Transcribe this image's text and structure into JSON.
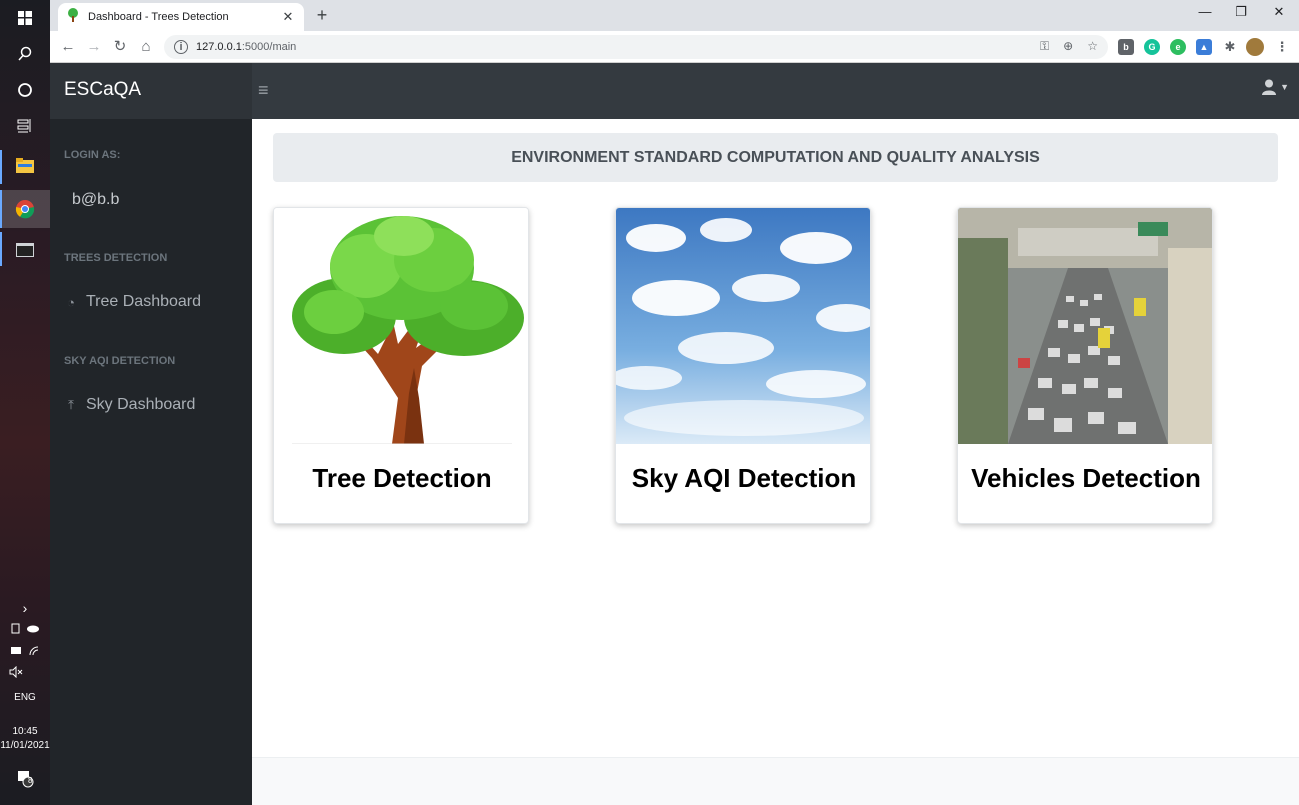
{
  "taskbar": {
    "icons": [
      "windows-start-icon",
      "search-icon",
      "cortana-icon",
      "task-view-icon",
      "file-explorer-icon",
      "chrome-icon",
      "terminal-icon"
    ],
    "tray": {
      "language": "ENG",
      "time": "10:45",
      "date": "11/01/2021",
      "notification_count": "8"
    }
  },
  "browser": {
    "tab_title": "Dashboard - Trees Detection",
    "url_host": "127.0.0.1",
    "url_rest": ":5000/main"
  },
  "app": {
    "brand": "ESCaQA",
    "sidebar": {
      "login_heading": "LOGIN AS:",
      "user": "b@b.b",
      "trees_heading": "TREES DETECTION",
      "tree_link": "Tree Dashboard",
      "sky_heading": "SKY AQI DETECTION",
      "sky_link": "Sky Dashboard"
    },
    "banner": "ENVIRONMENT STANDARD COMPUTATION AND QUALITY ANALYSIS",
    "cards": [
      {
        "title": "Tree Detection"
      },
      {
        "title": "Sky AQI Detection"
      },
      {
        "title": "Vehicles Detection"
      }
    ]
  },
  "colors": {
    "navbar": "#343a40",
    "sidebar": "#212529",
    "banner": "#e9ecef"
  }
}
